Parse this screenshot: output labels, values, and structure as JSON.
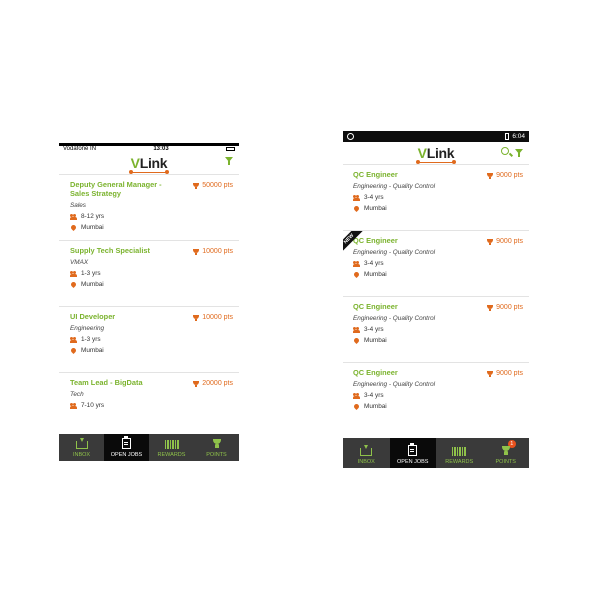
{
  "colors": {
    "brand_green": "#7bb32e",
    "accent_orange": "#e06a1d",
    "nav_bg": "#3a3a3a",
    "nav_active": "#0a0a0a"
  },
  "left_phone": {
    "status": {
      "carrier": "Vodafone IN",
      "time": "13:03"
    },
    "logo": {
      "v": "V",
      "rest": "Link"
    },
    "jobs": [
      {
        "title": "Deputy General Manager - Sales Strategy",
        "category": "Sales",
        "experience": "8-12 yrs",
        "location": "Mumbai",
        "points": "50000 pts"
      },
      {
        "title": "Supply Tech Specialist",
        "category": "VMAX",
        "experience": "1-3 yrs",
        "location": "Mumbai",
        "points": "10000 pts"
      },
      {
        "title": "UI Developer",
        "category": "Engineering",
        "experience": "1-3 yrs",
        "location": "Mumbai",
        "points": "10000 pts"
      },
      {
        "title": "Team Lead - BigData",
        "category": "Tech",
        "experience": "7-10 yrs",
        "location": "",
        "points": "20000 pts"
      }
    ],
    "nav": [
      {
        "label": "INBOX",
        "icon": "inbox-icon",
        "active": false
      },
      {
        "label": "OPEN JOBS",
        "icon": "clipboard-icon",
        "active": true
      },
      {
        "label": "REWARDS",
        "icon": "barcode-icon",
        "active": false
      },
      {
        "label": "POINTS",
        "icon": "trophy-icon",
        "active": false
      }
    ]
  },
  "right_phone": {
    "status": {
      "time": "6:04"
    },
    "logo": {
      "v": "V",
      "rest": "Link"
    },
    "jobs": [
      {
        "title": "QC Engineer",
        "category": "Engineering - Quality Control",
        "experience": "3-4 yrs",
        "location": "Mumbai",
        "points": "9000 pts",
        "is_new": false
      },
      {
        "title": "QC Engineer",
        "category": "Engineering - Quality Control",
        "experience": "3-4 yrs",
        "location": "Mumbai",
        "points": "9000 pts",
        "is_new": true,
        "new_label": "NEW"
      },
      {
        "title": "QC Engineer",
        "category": "Engineering - Quality Control",
        "experience": "3-4 yrs",
        "location": "Mumbai",
        "points": "9000 pts",
        "is_new": false
      },
      {
        "title": "QC Engineer",
        "category": "Engineering - Quality Control",
        "experience": "3-4 yrs",
        "location": "Mumbai",
        "points": "9000 pts",
        "is_new": false
      }
    ],
    "nav": [
      {
        "label": "INBOX",
        "icon": "inbox-icon",
        "active": false
      },
      {
        "label": "OPEN JOBS",
        "icon": "clipboard-icon",
        "active": true
      },
      {
        "label": "REWARDS",
        "icon": "barcode-icon",
        "active": false
      },
      {
        "label": "POINTS",
        "icon": "trophy-icon",
        "active": false,
        "badge": "1"
      }
    ]
  }
}
